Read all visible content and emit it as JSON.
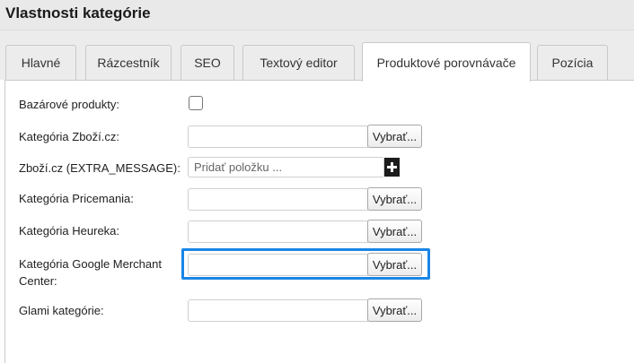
{
  "header": {
    "title": "Vlastnosti kategórie"
  },
  "tabs": [
    {
      "label": "Hlavné"
    },
    {
      "label": "Rázcestník"
    },
    {
      "label": "SEO"
    },
    {
      "label": "Textový editor"
    },
    {
      "label": "Produktové porovnávače",
      "active": true
    },
    {
      "label": "Pozícia"
    }
  ],
  "form": {
    "bazar_label": "Bazárové produkty:",
    "zbozi_label": "Kategória Zboží.cz:",
    "zbozi_extra_label": "Zboží.cz (EXTRA_MESSAGE):",
    "zbozi_extra_placeholder": "Pridať položku ...",
    "pricemania_label": "Kategória Pricemania:",
    "heureka_label": "Kategória Heureka:",
    "google_label": "Kategória Google Merchant Center:",
    "glami_label": "Glami kategórie:",
    "choose_label": "Vybrať..."
  },
  "colors": {
    "focus": "#1a85e6",
    "tab_bg": "#ececec"
  }
}
